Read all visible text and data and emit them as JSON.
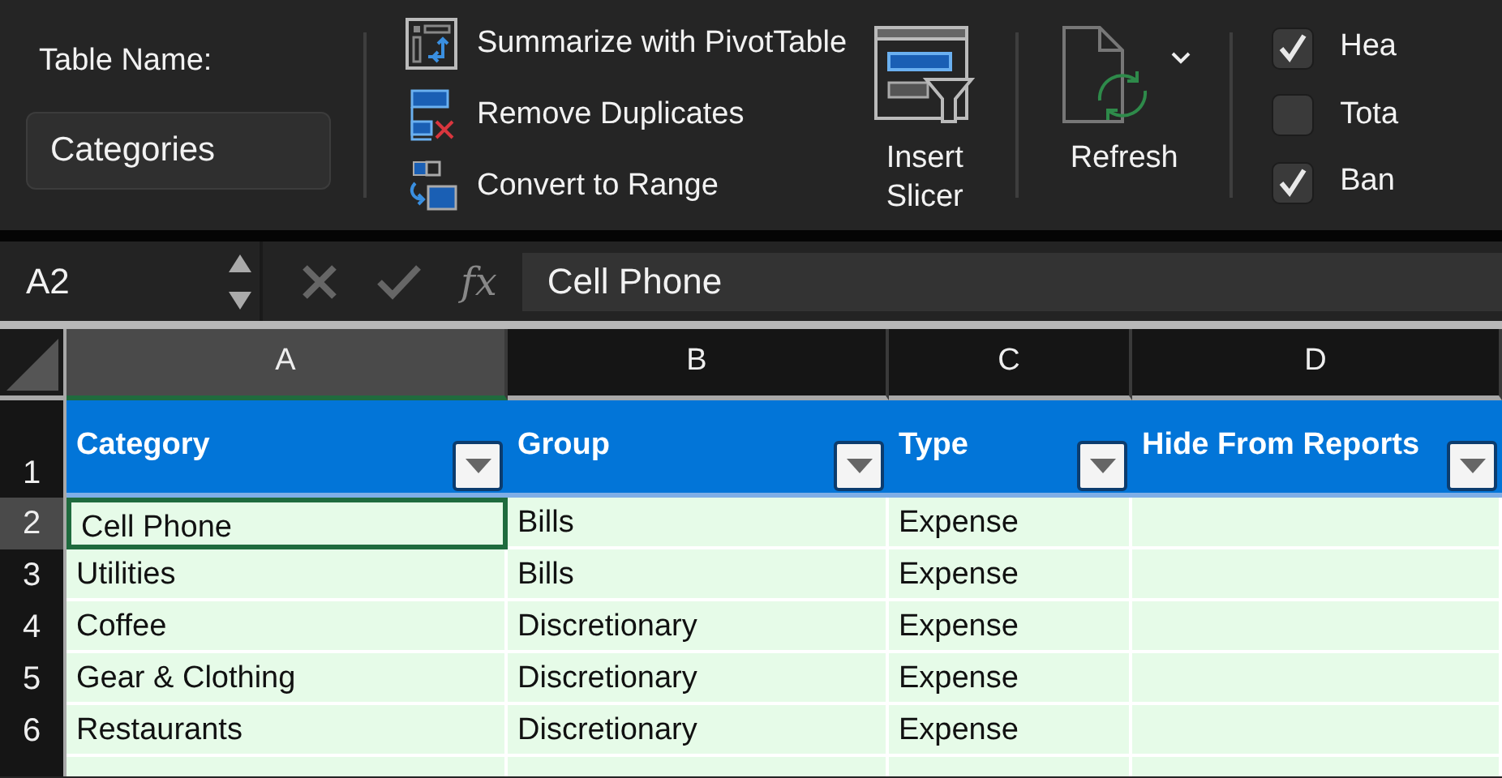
{
  "ribbon": {
    "table_name_label": "Table Name:",
    "table_name": "Categories",
    "tools": [
      {
        "label": "Summarize with PivotTable",
        "kind": "pivot"
      },
      {
        "label": "Remove Duplicates",
        "kind": "dedupe"
      },
      {
        "label": "Convert to Range",
        "kind": "convert"
      }
    ],
    "insert_slicer": "Insert Slicer",
    "refresh": "Refresh",
    "options": [
      {
        "label": "Hea",
        "checked": true
      },
      {
        "label": "Tota",
        "checked": false
      },
      {
        "label": "Ban",
        "checked": true
      }
    ]
  },
  "formula_bar": {
    "name_box": "A2",
    "fx_label": "fx",
    "formula": "Cell Phone"
  },
  "sheet": {
    "columns": [
      {
        "label": "A",
        "selected": true
      },
      {
        "label": "B",
        "selected": false
      },
      {
        "label": "C",
        "selected": false
      },
      {
        "label": "D",
        "selected": false
      }
    ],
    "header_row": {
      "number": "1",
      "headers": [
        "Category",
        "Group",
        "Type",
        "Hide From Reports"
      ]
    },
    "rows": [
      {
        "number": "2",
        "selected": true,
        "cells": [
          "Cell Phone",
          "Bills",
          "Expense"
        ]
      },
      {
        "number": "3",
        "selected": false,
        "cells": [
          "Utilities",
          "Bills",
          "Expense"
        ]
      },
      {
        "number": "4",
        "selected": false,
        "cells": [
          "Coffee",
          "Discretionary",
          "Expense"
        ]
      },
      {
        "number": "5",
        "selected": false,
        "cells": [
          "Gear & Clothing",
          "Discretionary",
          "Expense"
        ]
      },
      {
        "number": "6",
        "selected": false,
        "cells": [
          "Restaurants",
          "Discretionary",
          "Expense"
        ]
      }
    ]
  }
}
